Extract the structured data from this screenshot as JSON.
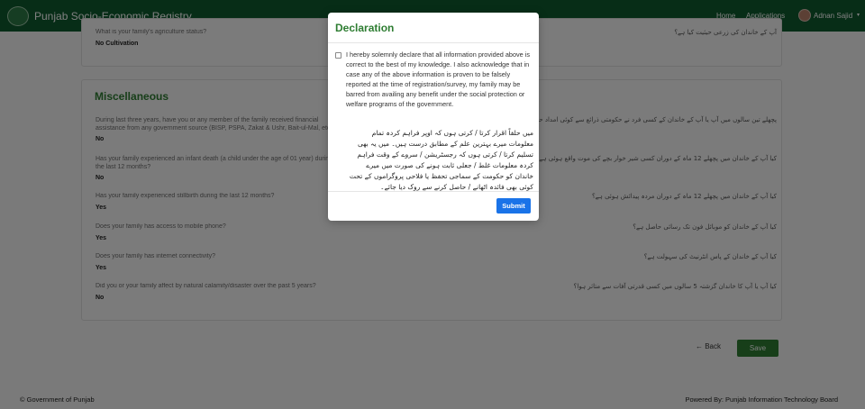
{
  "header": {
    "app_title": "Punjab Socio-Economic Registry",
    "nav": [
      "Home",
      "Applications"
    ],
    "user_name": "Adnan Sajid",
    "caret": "▾"
  },
  "top_card": {
    "question": "What is your family's agriculture status?",
    "answer": "No Cultivation",
    "urdu": "آپ کے خاندان کی زرعی حیثیت کیا ہے؟"
  },
  "misc": {
    "title": "Miscellaneous",
    "questions": [
      {
        "text": "During last three years, have you or any member of the family received financial assistance from any government source (BISP, PSPA, Zakat & Ushr, Bait-ul-Mal, etc.)?",
        "answer": "No",
        "urdu": "پچھلے تین سالوں میں آپ یا آپ کے خاندان کے کسی فرد نے حکومتی ذرائع سے کوئی امداد حاصل کی ہے؟"
      },
      {
        "text": "Has your family experienced an infant death (a child under the age of 01 year) during the last 12 months?",
        "answer": "No",
        "urdu": "کیا آپ کے خاندان میں پچھلے 12 ماہ کے دوران کسی شیر خوار بچے کی موت واقع ہوئی ہے؟"
      },
      {
        "text": "Has your family experienced stillbirth during the last 12 months?",
        "answer": "Yes",
        "urdu": "کیا آپ کے خاندان میں پچھلے 12 ماہ کے دوران مردہ پیدائش ہوئی ہے؟"
      },
      {
        "text": "Does your family has access to mobile phone?",
        "answer": "Yes",
        "urdu": "کیا آپ کے خاندان کو موبائل فون تک رسائی حاصل ہے؟"
      },
      {
        "text": "Does your family has internet connectivity?",
        "answer": "Yes",
        "urdu": "کیا آپ کے خاندان کے پاس انٹرنیٹ کی سہولت ہے؟"
      },
      {
        "text": "Did you or your family affect by natural calamity/disaster over the past 5 years?",
        "answer": "No",
        "urdu": "کیا آپ یا آپ کا خاندان گزشتہ 5 سالوں میں کسی قدرتی آفات سے متاثر ہوا؟"
      }
    ]
  },
  "actions": {
    "back": "← Back",
    "save": "Save"
  },
  "footer": {
    "left": "© Government of Punjab",
    "right": "Powered By: Punjab Information Technology Board"
  },
  "modal": {
    "title": "Declaration",
    "text": "I hereby solemnly declare that all information provided above is correct to the best of my knowledge. I also acknowledge that in case any of the above information is proven to be falsely reported at the time of registration/survey, my family may be barred from availing any benefit under the social protection or welfare programs of the government.",
    "urdu": "میں حلفاً اقرار کرتا / کرتی ہوں کہ اوپر فراہم کردہ تمام معلومات میرے بہترین علم کے مطابق درست ہیں۔ میں یہ بھی تسلیم کرتا / کرتی ہوں کہ رجسٹریشن / سروے کے وقت فراہم کردہ معلومات غلط / جعلی ثابت ہونے کی صورت میں میرے خاندان کو حکومت کے سماجی تحفظ یا فلاحی پروگراموں کے تحت کوئی بھی فائدہ اٹھانے / حاصل کرنے سے روک دیا جائے۔",
    "submit": "Submit"
  }
}
